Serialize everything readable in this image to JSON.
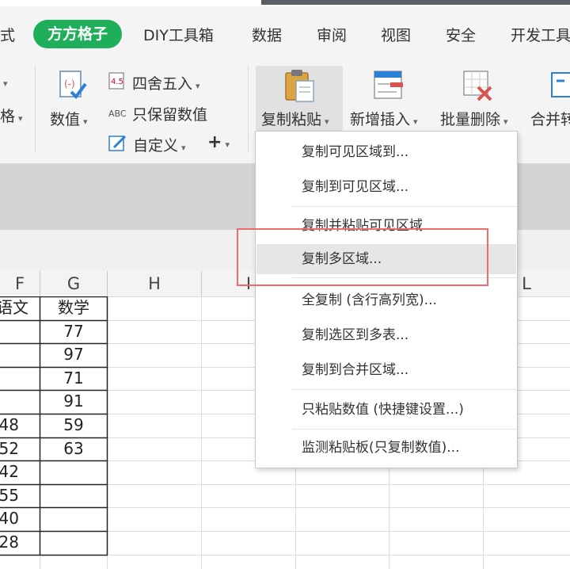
{
  "menu": {
    "partial_left": "式",
    "active_tab": "方方格子",
    "tabs": [
      "DIY工具箱",
      "数据",
      "审阅",
      "视图",
      "安全",
      "开发工具"
    ]
  },
  "ribbon": {
    "left_partial_label": "格",
    "value_button": "数值",
    "round_button": "四舍五入",
    "keep_value_button": "只保留数值",
    "custom_button": "自定义",
    "plus_label": "+",
    "copy_paste_button": "复制粘贴",
    "insert_button": "新增插入",
    "batch_delete_button": "批量删除",
    "merge_button_partial": "合并转"
  },
  "dropdown": {
    "items": [
      "复制可见区域到...",
      "复制到可见区域...",
      "复制并粘贴可见区域...",
      "复制多区域...",
      "全复制 (含行高列宽)...",
      "复制选区到多表...",
      "复制到合并区域...",
      "只粘贴数值 (快捷键设置...)",
      "监测粘贴板(只复制数值)..."
    ],
    "highlighted_index": 3
  },
  "sheet": {
    "column_headers": [
      "F",
      "G",
      "H",
      "I",
      "L"
    ],
    "col_f_header_partial": "语文",
    "col_g_header": "数学",
    "col_f_values": [
      "",
      "",
      "",
      "",
      "48",
      "52",
      "42",
      "55",
      "40",
      "28"
    ],
    "col_g_values": [
      "77",
      "97",
      "71",
      "91",
      "59",
      "63",
      "",
      "",
      "",
      ""
    ]
  },
  "colors": {
    "active_tab_bg": "#1fae5a",
    "highlight_box": "#ef6b6b"
  }
}
